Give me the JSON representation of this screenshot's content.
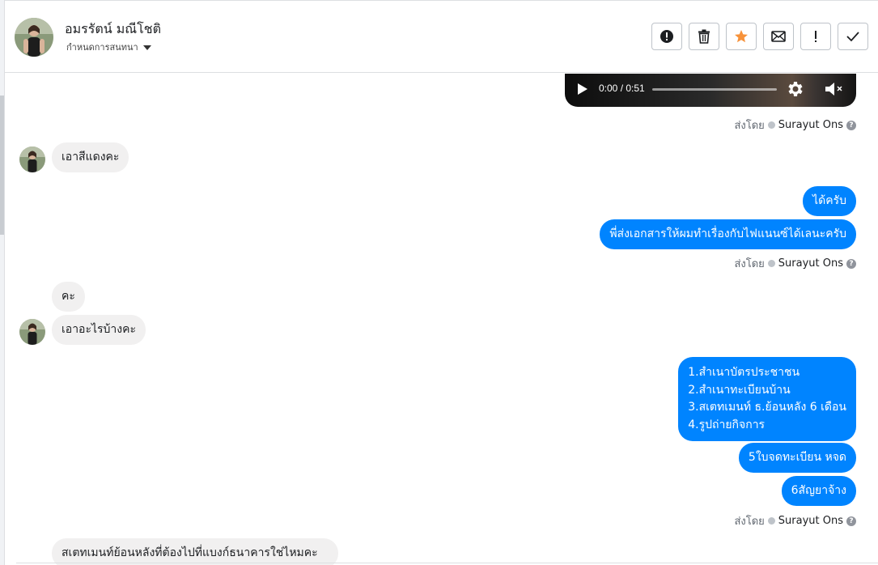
{
  "header": {
    "name": "อมรรัตน์ มณีโชติ",
    "subtitle": "กำหนดการสนทนา"
  },
  "actions": [
    {
      "icon": "alert-circle-icon",
      "label": ""
    },
    {
      "icon": "trash-icon",
      "label": ""
    },
    {
      "icon": "star-icon",
      "label": ""
    },
    {
      "icon": "envelope-icon",
      "label": ""
    },
    {
      "icon": "exclamation-icon",
      "label": ""
    },
    {
      "icon": "check-icon",
      "label": ""
    }
  ],
  "colors": {
    "outgoing_bubble": "#0084ff",
    "incoming_bubble": "#f1f0f0",
    "star": "#f7923a"
  },
  "video": {
    "time": "0:00 / 0:51"
  },
  "sent_by": {
    "prefix": "ส่งโดย",
    "name": "Surayut Ons"
  },
  "messages": {
    "in1": "เอาสีแดงคะ",
    "out1": "ได้ครับ",
    "out2": "พี่ส่งเอกสารให้ผมทำเรื่องกับไฟแนนซ์ได้เลนะครับ",
    "in2": "คะ",
    "in3": "เอาอะไรบ้างคะ",
    "out3_lines": [
      "1.สำเนาบัตรประชาชน",
      "2.สำเนาทะเบียนบ้าน",
      "3.สเตทเมนท์ ธ.ย้อนหลัง 6 เดือน",
      "4.รูปถ่ายกิจการ"
    ],
    "out4": "5ใบจดทะเบียน หจด",
    "out5": "6สัญยาจ้าง",
    "in4_partial": "สเตทเมนท์ย้อนหลังที่ต้องไปที่แบงก์ธนาคารใช่ไหมคะ"
  }
}
